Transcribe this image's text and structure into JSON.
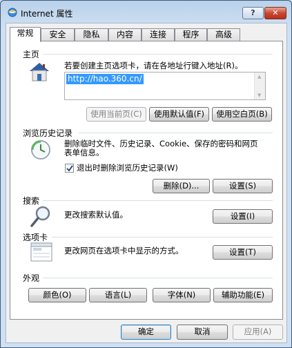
{
  "window": {
    "title": "Internet 属性",
    "help_label": "?",
    "close_label": "✕"
  },
  "tabs": [
    "常规",
    "安全",
    "隐私",
    "内容",
    "连接",
    "程序",
    "高级"
  ],
  "home": {
    "title": "主页",
    "desc": "若要创建主页选项卡，请在各地址行键入地址(R)。",
    "url": "http://hao.360.cn/",
    "btn_current": "使用当前页(C)",
    "btn_default": "使用默认值(F)",
    "btn_blank": "使用空白页(B)"
  },
  "history": {
    "title": "浏览历史记录",
    "desc1": "删除临时文件、历史记录、Cookie、保存的密码和网页",
    "desc2": "表单信息。",
    "checkbox_label": "退出时删除浏览历史记录(W)",
    "checkbox_checked": true,
    "btn_delete": "删除(D)...",
    "btn_settings": "设置(S)"
  },
  "search": {
    "title": "搜索",
    "desc": "更改搜索默认值。",
    "btn_settings": "设置(I)"
  },
  "tabs_section": {
    "title": "选项卡",
    "desc": "更改网页在选项卡中显示的方式。",
    "btn_settings": "设置(T)"
  },
  "appearance": {
    "title": "外观",
    "btn_colors": "颜色(O)",
    "btn_languages": "语言(L)",
    "btn_fonts": "字体(N)",
    "btn_accessibility": "辅助功能(E)"
  },
  "footer": {
    "ok": "确定",
    "cancel": "取消",
    "apply": "应用(A)"
  }
}
